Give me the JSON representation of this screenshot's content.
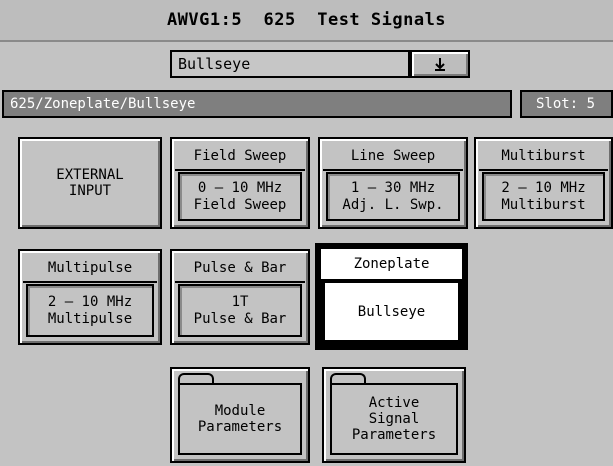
{
  "window": {
    "title": "AWVG1:5  625  Test Signals"
  },
  "selector": {
    "value": "Bullseye",
    "dropdown_icon": "down-arrow-icon"
  },
  "path": {
    "text": "625/Zoneplate/Bullseye",
    "slot": "Slot: 5"
  },
  "buttons": {
    "external": {
      "line1": "EXTERNAL",
      "line2": "INPUT"
    },
    "field_sweep": {
      "head": "Field Sweep",
      "line1": "0 – 10 MHz",
      "line2": "Field Sweep"
    },
    "line_sweep": {
      "head": "Line Sweep",
      "line1": "1 – 30 MHz",
      "line2": "Adj. L. Swp."
    },
    "multiburst": {
      "head": "Multiburst",
      "line1": "2 – 10 MHz",
      "line2": "Multiburst"
    },
    "multipulse": {
      "head": "Multipulse",
      "line1": "2 – 10 MHz",
      "line2": "Multipulse"
    },
    "pulse_bar": {
      "head": "Pulse & Bar",
      "line1": "1T",
      "line2": "Pulse & Bar"
    },
    "zoneplate": {
      "head": "Zoneplate",
      "line1": "Bullseye"
    }
  },
  "folders": {
    "module": {
      "line1": "Module",
      "line2": "Parameters"
    },
    "active": {
      "line1": "Active",
      "line2": "Signal",
      "line3": "Parameters"
    }
  }
}
